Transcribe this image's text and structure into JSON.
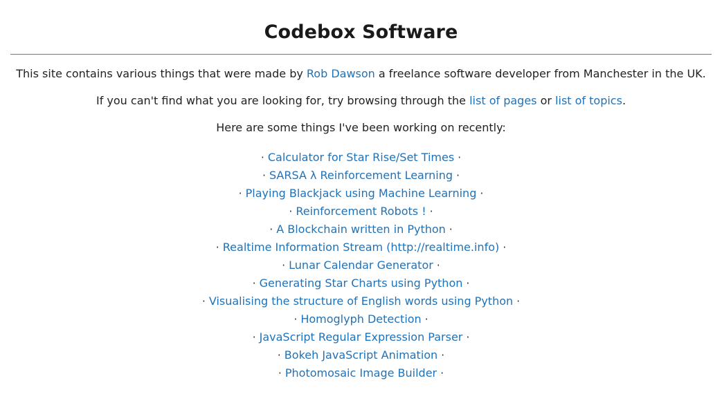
{
  "header": {
    "title": "Codebox Software"
  },
  "intro": {
    "line1": {
      "before_link": "This site contains various things that were made by ",
      "link": "Rob Dawson",
      "after_link": " a freelance software developer from Manchester in the UK."
    },
    "line2": {
      "before_link1": "If you can't find what you are looking for, try browsing through the ",
      "link1": "list of pages",
      "between_links": " or ",
      "link2": "list of topics",
      "after_link2": "."
    },
    "line3": "Here are some things I've been working on recently:"
  },
  "separator": "·",
  "recent_items": [
    {
      "label": "Calculator for Star Rise/Set Times"
    },
    {
      "label": "SARSA λ Reinforcement Learning"
    },
    {
      "label": "Playing Blackjack using Machine Learning"
    },
    {
      "label": "Reinforcement Robots !"
    },
    {
      "label": "A Blockchain written in Python"
    },
    {
      "label": "Realtime Information Stream (http://realtime.info)"
    },
    {
      "label": "Lunar Calendar Generator"
    },
    {
      "label": "Generating Star Charts using Python"
    },
    {
      "label": "Visualising the structure of English words using Python"
    },
    {
      "label": "Homoglyph Detection"
    },
    {
      "label": "JavaScript Regular Expression Parser"
    },
    {
      "label": "Bokeh JavaScript Animation"
    },
    {
      "label": "Photomosaic Image Builder"
    }
  ],
  "colors": {
    "link": "#1f72b8",
    "text": "#222222",
    "rule": "#777777",
    "background": "#ffffff"
  }
}
